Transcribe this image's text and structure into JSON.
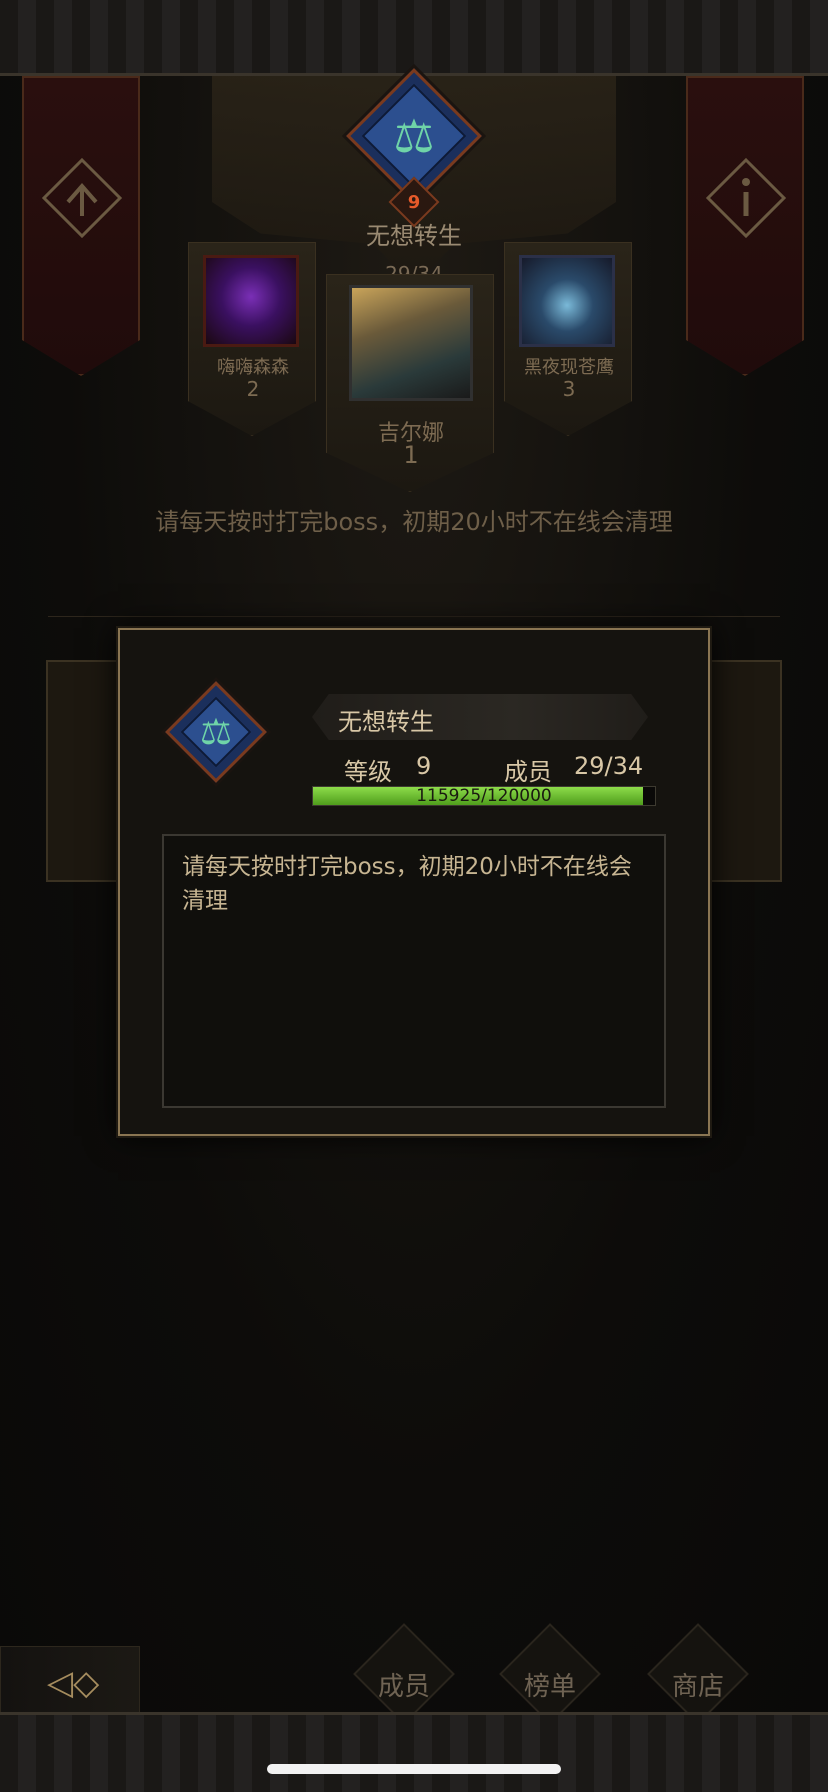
{
  "guild": {
    "name": "无想转生",
    "level": "9",
    "members": "29/34"
  },
  "podium": [
    {
      "name": "嗨嗨森森",
      "rank": "2"
    },
    {
      "name": "吉尔娜",
      "rank": "1"
    },
    {
      "name": "黑夜现苍鹰",
      "rank": "3"
    }
  ],
  "notice_preview": "请每天按时打完boss，初期20小时不在线会清理",
  "modal": {
    "name": "无想转生",
    "level_label": "等级",
    "level_value": "9",
    "members_label": "成员",
    "members_value": "29/34",
    "xp_text": "115925/120000",
    "xp_fraction": 0.966,
    "notice_text": "请每天按时打完boss，初期20小时不在线会清理"
  },
  "nav": {
    "members": "成员",
    "ranking": "榜单",
    "shop": "商店"
  },
  "colors": {
    "gold": "#c9b48a",
    "banner_red": "#2a0f0e",
    "emblem_blue": "#2c4f8f",
    "xp_green": "#6cc233",
    "level_orange": "#e65a2a"
  },
  "icons": {
    "back": "back-arrow-icon",
    "emblem": "goddess-scales-emblem-icon"
  }
}
